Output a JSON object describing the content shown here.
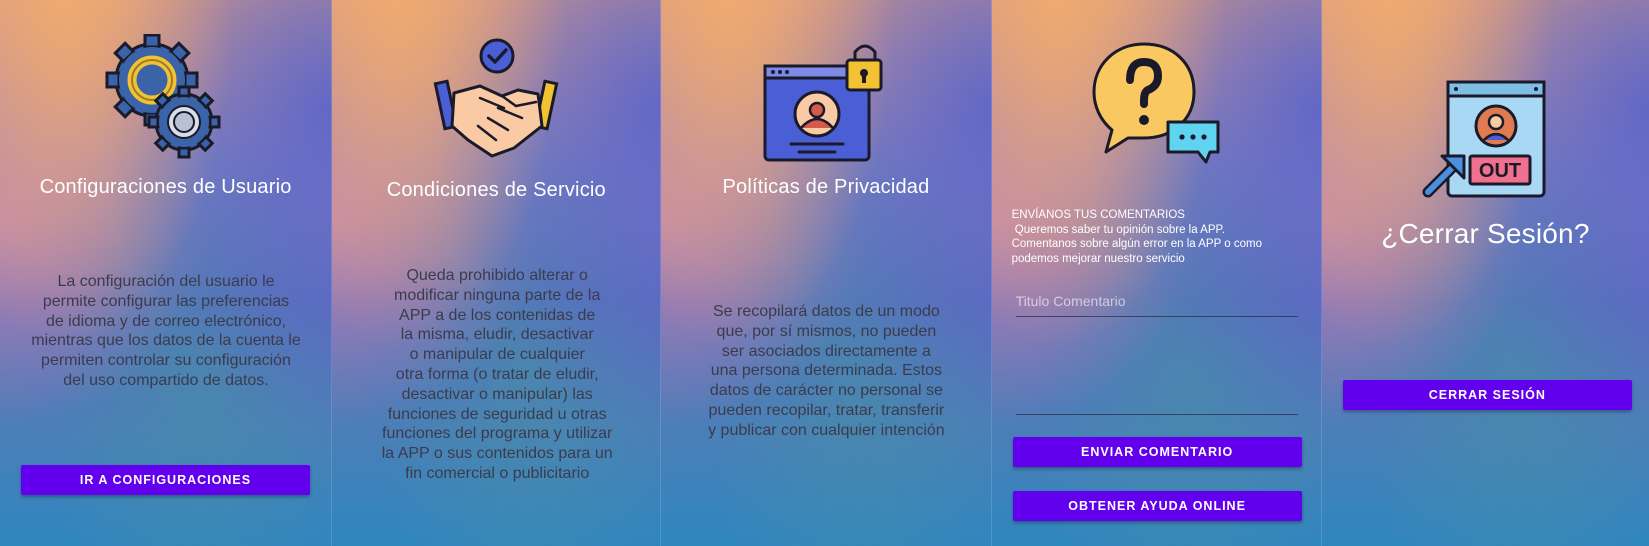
{
  "panels": {
    "settings": {
      "icon": "gears-icon",
      "title": "Configuraciones de Usuario",
      "body_lines": [
        "La configuración del usuario le",
        "permite configurar las preferencias",
        "de idioma y de correo electrónico,",
        "mientras que los datos de la cuenta le",
        "permiten controlar su configuración",
        "del uso compartido de datos."
      ],
      "button_label": "IR A CONFIGURACIONES"
    },
    "terms": {
      "icon": "handshake-icon",
      "title": "Condiciones de Servicio",
      "body_lines": [
        "Queda prohibido alterar o",
        "modificar ninguna parte de la",
        "APP a de los contenidas de",
        "la misma, eludir, desactivar",
        "o manipular de cualquier",
        "otra forma (o tratar de eludir,",
        "desactivar o manipular) las",
        "funciones de seguridad u otras",
        "funciones del programa y utilizar",
        "la APP o sus contenidos para un",
        "fin comercial o publicitario"
      ]
    },
    "privacy": {
      "icon": "privacy-lock-icon",
      "title": "Políticas de Privacidad",
      "body_lines": [
        "Se recopilará datos de un modo",
        "que, por sí mismos, no pueden",
        "ser asociados directamente a",
        "una persona determinada. Estos",
        "datos de carácter no personal se",
        "pueden recopilar, tratar, transferir",
        "y publicar con cualquier intención"
      ]
    },
    "feedback": {
      "icon": "question-chat-icon",
      "label_lines": [
        "ENVÍANOS TUS COMENTARIOS",
        " Queremos saber tu opinión sobre la APP.",
        "Comentanos sobre algún error en la APP o como",
        "podemos mejorar nuestro servicio"
      ],
      "title_placeholder": "Titulo Comentario",
      "comment_value": "",
      "send_button": "ENVIAR COMENTARIO",
      "help_button": "OBTENER AYUDA ONLINE"
    },
    "logout": {
      "icon": "logout-icon",
      "title": "¿Cerrar Sesión?",
      "button_label": "CERRAR SESIÓN"
    }
  },
  "colors": {
    "accent": "#6200ee"
  }
}
